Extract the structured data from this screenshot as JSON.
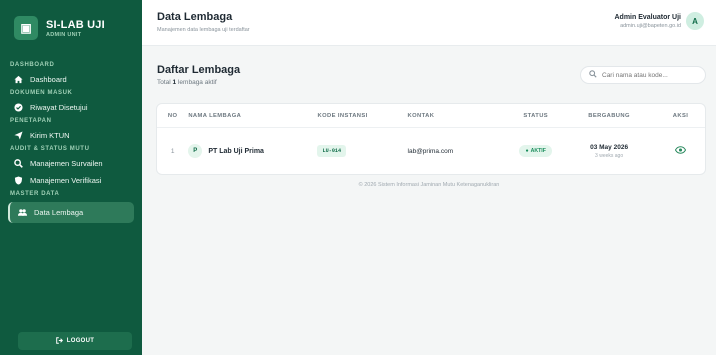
{
  "brand": {
    "logo_glyph": "▣",
    "name": "SI-LAB UJI",
    "tagline": "ADMIN UNIT"
  },
  "sidebar": {
    "sections": [
      {
        "label": "DASHBOARD",
        "items": [
          {
            "label": "Dashboard",
            "icon": "home-icon"
          }
        ]
      },
      {
        "label": "DOKUMEN MASUK",
        "items": [
          {
            "label": "Riwayat Disetujui",
            "icon": "check-circle-icon"
          }
        ]
      },
      {
        "label": "PENETAPAN",
        "items": [
          {
            "label": "Kirim KTUN",
            "icon": "send-icon"
          }
        ]
      },
      {
        "label": "AUDIT & STATUS MUTU",
        "items": [
          {
            "label": "Manajemen Survailen",
            "icon": "search-icon"
          },
          {
            "label": "Manajemen Verifikasi",
            "icon": "shield-icon"
          }
        ]
      },
      {
        "label": "MASTER DATA",
        "items": [
          {
            "label": "Data Lembaga",
            "icon": "users-icon",
            "active": true
          }
        ]
      }
    ],
    "logout_label": "LOGOUT"
  },
  "header": {
    "title": "Data Lembaga",
    "subtitle": "Manajemen data lembaga uji terdaftar",
    "user_name": "Admin Evaluator Uji",
    "user_email": "admin.uji@bapeten.go.id",
    "avatar_initial": "A"
  },
  "main": {
    "title": "Daftar Lembaga",
    "sub_prefix": "Total",
    "sub_count": "1",
    "sub_suffix": "lembaga aktif",
    "search_placeholder": "Cari nama atau kode..."
  },
  "table": {
    "headers": [
      "NO",
      "NAMA LEMBAGA",
      "KODE INSTANSI",
      "KONTAK",
      "STATUS",
      "BERGABUNG",
      "AKSI"
    ],
    "rows": [
      {
        "no": "1",
        "initial": "P",
        "nama": "PT Lab Uji Prima",
        "kode": "LU-014",
        "kontak": "lab@prima.com",
        "status": "AKTIF",
        "bergabung": "03 May 2026",
        "relative": "3 weeks ago"
      }
    ]
  },
  "footer": "© 2026 Sistem Informasi Jaminan Mutu Ketenaganukliran",
  "colors": {
    "sidebar": "#0f5a3f",
    "accent": "#1a8d5c",
    "active_item": "#2e7a5a"
  }
}
